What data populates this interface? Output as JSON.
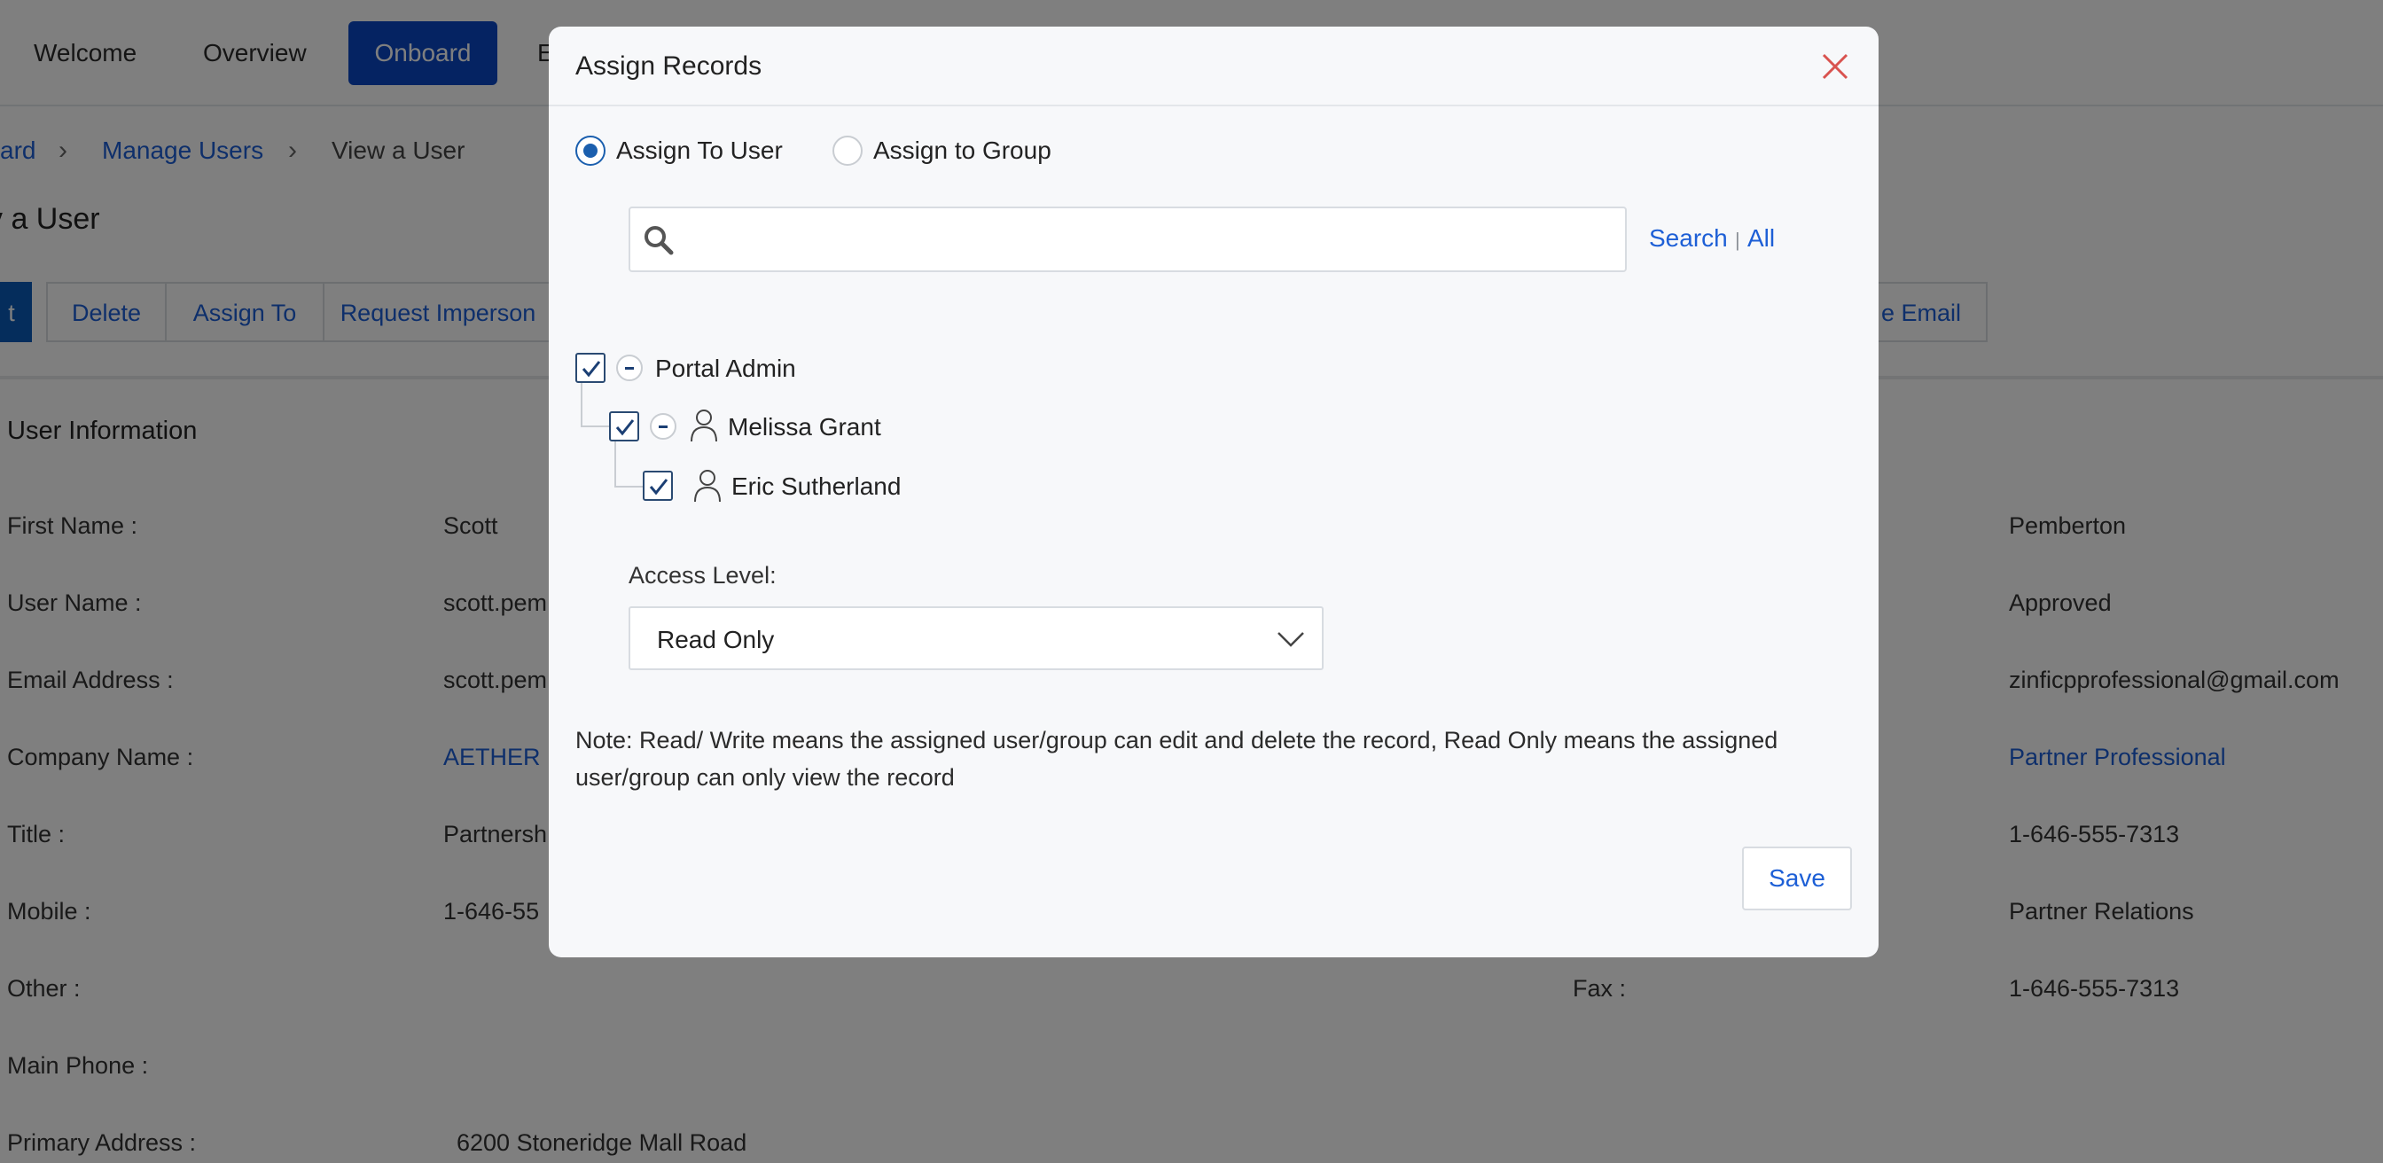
{
  "nav": {
    "tabs": [
      {
        "label": "Welcome"
      },
      {
        "label": "Overview"
      },
      {
        "label": "Onboard",
        "active": true
      },
      {
        "label": "E"
      }
    ]
  },
  "breadcrumb": {
    "items": [
      "ard",
      "Manage Users",
      "View a User"
    ]
  },
  "page_title": "v a User",
  "actions": {
    "first_label": "t",
    "delete_label": "Delete",
    "assign_to_label": "Assign To",
    "request_impersonation_label": "Request Imperson",
    "email_label": "e Email"
  },
  "user_info": {
    "section_title": "User Information",
    "fields": {
      "first_name": {
        "label": "First Name :",
        "value": "Scott"
      },
      "user_name": {
        "label": "User Name :",
        "value": "scott.pem"
      },
      "email": {
        "label": "Email Address :",
        "value": "scott.pem"
      },
      "company": {
        "label": "Company Name :",
        "value": "AETHER F"
      },
      "title": {
        "label": "Title :",
        "value": "Partnersh"
      },
      "mobile": {
        "label": "Mobile :",
        "value": "1-646-55"
      },
      "other": {
        "label": "Other :",
        "value": ""
      },
      "main_phone": {
        "label": "Main Phone :",
        "value": ""
      },
      "primary_address": {
        "label": "Primary Address :",
        "value": "6200 Stoneridge Mall Road"
      },
      "fax": {
        "label": "Fax :",
        "value": "1-646-555-7313"
      }
    },
    "right_values": {
      "last_name": "Pemberton",
      "status": "Approved",
      "alt_email": "zinficpprofessional@gmail.com",
      "partner_type": "Partner Professional",
      "phone": "1-646-555-7313",
      "department": "Partner Relations"
    }
  },
  "modal": {
    "title": "Assign Records",
    "radio": {
      "assign_to_user": "Assign To User",
      "assign_to_group": "Assign to Group",
      "selected": "assign_to_user"
    },
    "search": {
      "value": "",
      "placeholder": "",
      "search_label": "Search",
      "separator": "|",
      "all_label": "All"
    },
    "tree": {
      "root": {
        "label": "Portal Admin",
        "checked": true
      },
      "child": {
        "label": "Melissa Grant",
        "checked": true
      },
      "grandchild": {
        "label": "Eric Sutherland",
        "checked": true
      }
    },
    "access_level": {
      "label": "Access Level:",
      "value": "Read Only"
    },
    "note": "Note: Read/ Write means the assigned user/group can edit and delete the record, Read Only means the assigned user/group can only view the record",
    "save_label": "Save"
  },
  "colors": {
    "accent": "#1d5fd6",
    "nav_active": "#0a47c4",
    "checkbox": "#1b5fae",
    "close": "#d9534f"
  }
}
